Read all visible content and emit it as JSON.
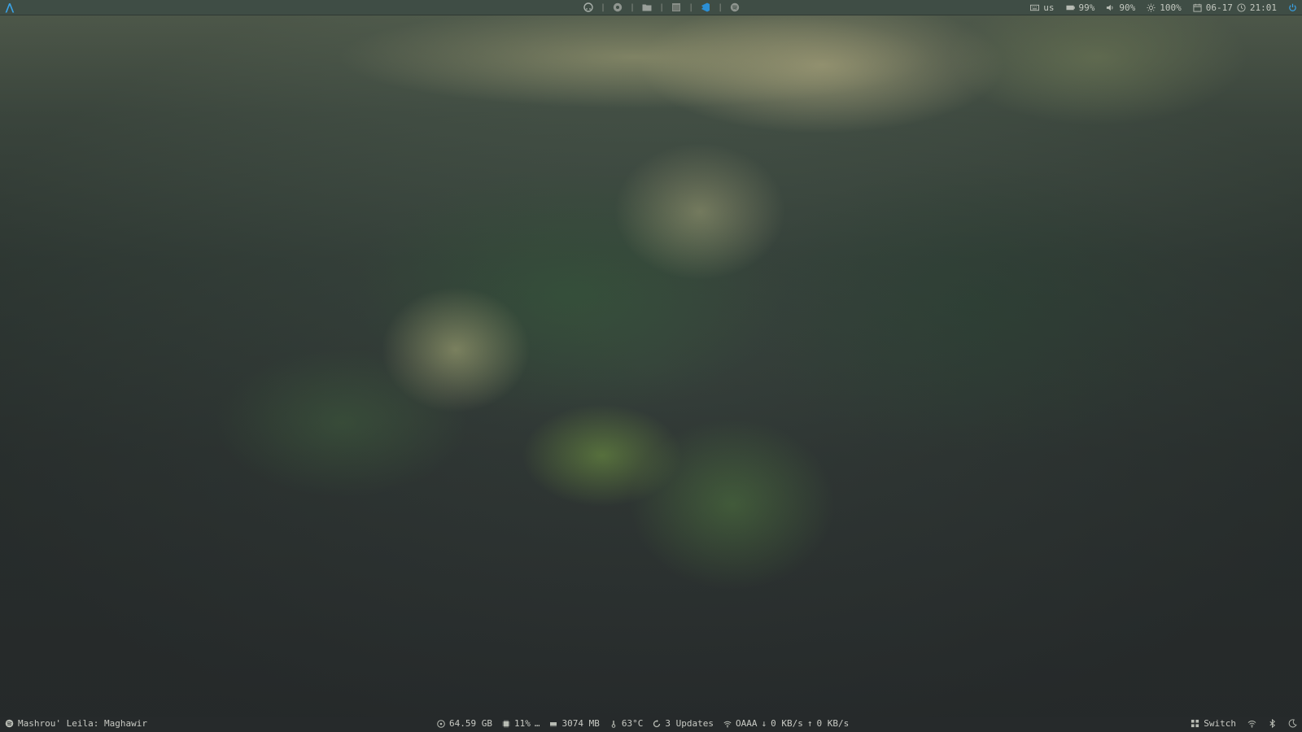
{
  "topbar": {
    "launchers": [
      {
        "icon": "github-icon"
      },
      {
        "icon": "chromium-icon"
      },
      {
        "icon": "folder-icon"
      },
      {
        "icon": "window-icon"
      },
      {
        "icon": "vscode-icon"
      },
      {
        "icon": "spotify-icon"
      }
    ],
    "separator": "|",
    "keyboard_layout": "us",
    "battery": "99%",
    "volume": "90%",
    "brightness": "100%",
    "date": "06-17",
    "time": "21:01",
    "accent_color": "#3aa3e8"
  },
  "bottombar": {
    "now_playing": "Mashrou' Leila: Maghawir",
    "disk": "64.59 GB",
    "cpu": "11%",
    "cpu_graph": "…",
    "memory": "3074 MB",
    "temperature": "63°C",
    "updates": "3 Updates",
    "wifi_ssid": "OAAA",
    "download": "0 KB/s",
    "upload": "0 KB/s",
    "switch_label": "Switch"
  }
}
